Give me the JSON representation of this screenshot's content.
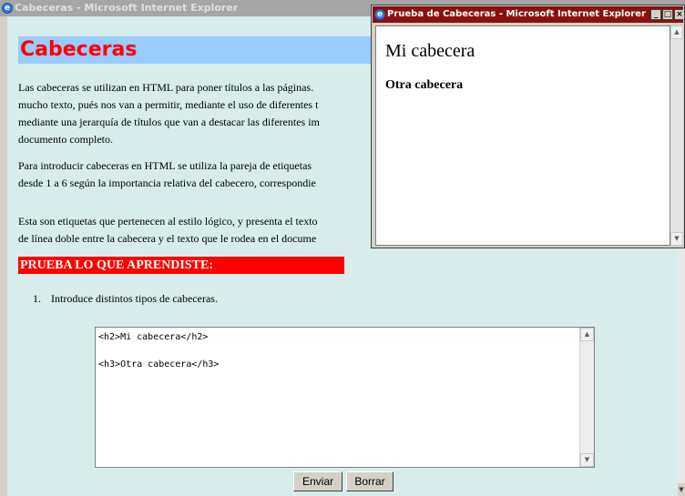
{
  "main_window": {
    "title": "Cabeceras - Microsoft Internet Explorer",
    "heading": "Cabeceras",
    "paragraphs": [
      "Las cabeceras se utilizan en HTML para poner títulos a las páginas.\nmucho texto, pués nos van a permitir, mediante el uso de diferentes t\nmediante una jerarquía de títulos que van a destacar las diferentes im\ndocumento completo.",
      "Para introducir cabeceras en HTML se utiliza la pareja de etiquetas\ndesde 1 a 6 según la importancia relativa del cabecero, correspondie",
      "Esta son etiquetas que pertenecen al estilo lógico, y presenta el texto\nde línea doble entre la cabecera y el texto que le rodea en el docume"
    ],
    "practice_heading": "PRUEBA LO QUE APRENDISTE:",
    "list_number": "1.",
    "list_item": "Introduce distintos tipos de cabeceras.",
    "code": "<h2>Mi cabecera</h2>\n\n<h3>Otra cabecera</h3>",
    "buttons": {
      "send": "Enviar",
      "clear": "Borrar"
    }
  },
  "popup_window": {
    "title": "Prueba de Cabeceras - Microsoft Internet Explorer",
    "h2_text": "Mi cabecera",
    "h3_text": "Otra cabecera",
    "controls": {
      "minimize": "_",
      "maximize": "□",
      "close": "×"
    }
  },
  "icons": {
    "window_icon": "ie-icon",
    "scroll_up": "▲",
    "scroll_down": "▼"
  },
  "colors": {
    "heading_bg": "#99ccff",
    "heading_text": "#ff0000",
    "practice_bg": "#ff0000",
    "page_bg": "#d8ecec",
    "popup_title_bg": "#8a1010"
  }
}
